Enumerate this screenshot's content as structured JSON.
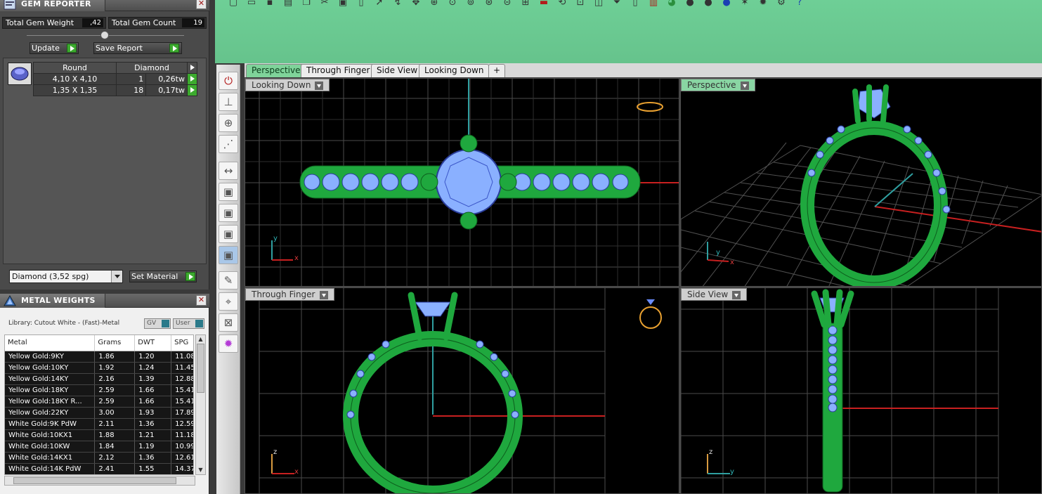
{
  "gem_panel": {
    "title": "GEM REPORTER",
    "total_weight_label": "Total Gem Weight",
    "total_weight_value": ",42",
    "total_count_label": "Total Gem Count",
    "total_count_value": "19",
    "update_label": "Update",
    "save_report_label": "Save Report",
    "table_headers": [
      "Round",
      "Diamond"
    ],
    "rows": [
      {
        "size": "4,10 X 4,10",
        "count": "1",
        "weight": "0,26tw"
      },
      {
        "size": "1,35 X 1,35",
        "count": "18",
        "weight": "0,17tw"
      }
    ],
    "material_value": "Diamond    (3,52 spg)",
    "set_material_label": "Set Material"
  },
  "metal_panel": {
    "title": "METAL WEIGHTS",
    "library_text": "Library: Cutout White - (Fast)-Metal",
    "gv_label": "GV",
    "user_label": "User",
    "headers": [
      "Metal",
      "Grams",
      "DWT",
      "SPG"
    ],
    "rows": [
      [
        "Yellow Gold:9KY",
        "1.86",
        "1.20",
        "11.08"
      ],
      [
        "Yellow Gold:10KY",
        "1.92",
        "1.24",
        "11.45"
      ],
      [
        "Yellow Gold:14KY",
        "2.16",
        "1.39",
        "12.88"
      ],
      [
        "Yellow Gold:18KY",
        "2.59",
        "1.66",
        "15.41"
      ],
      [
        "Yellow Gold:18KY R...",
        "2.59",
        "1.66",
        "15.41"
      ],
      [
        "Yellow Gold:22KY",
        "3.00",
        "1.93",
        "17.89"
      ],
      [
        "White Gold:9K PdW",
        "2.11",
        "1.36",
        "12.59"
      ],
      [
        "White Gold:10KX1",
        "1.88",
        "1.21",
        "11.18"
      ],
      [
        "White Gold:10KW",
        "1.84",
        "1.19",
        "10.99"
      ],
      [
        "White Gold:14KX1",
        "2.12",
        "1.36",
        "12.61"
      ],
      [
        "White Gold:14K PdW",
        "2.41",
        "1.55",
        "14.37"
      ]
    ]
  },
  "viewport_tabs": [
    "Perspective",
    "Through Finger",
    "Side View",
    "Looking Down",
    "+"
  ],
  "viewports": {
    "top_left": "Looking Down",
    "top_right": "Perspective",
    "bottom_left": "Through Finger",
    "bottom_right": "Side View"
  },
  "axes": {
    "x": "x",
    "y": "y",
    "z": "z"
  },
  "colors": {
    "ring": "#22b84a",
    "gem": "#8ab0ff",
    "grid": "#5a5a5a",
    "accent": "#66c38c"
  }
}
